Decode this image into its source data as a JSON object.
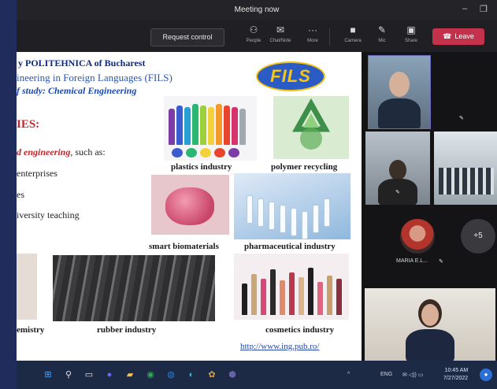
{
  "window": {
    "title": "Meeting now",
    "minimize": "–",
    "restore": "❐"
  },
  "toolbar": {
    "request_control": "Request control",
    "buttons": [
      {
        "icon": "people-icon",
        "glyph": "⚇",
        "label": "People"
      },
      {
        "icon": "chat-icon",
        "glyph": "✉",
        "label": "Chat/Note"
      },
      {
        "icon": "more-icon",
        "glyph": "···",
        "label": "More"
      },
      {
        "icon": "camera-icon",
        "glyph": "■",
        "label": "Camera"
      },
      {
        "icon": "mic-icon",
        "glyph": "✎",
        "label": "Mic"
      },
      {
        "icon": "share-icon",
        "glyph": "▣",
        "label": "Share"
      }
    ],
    "leave_label": "Leave",
    "leave_glyph": "☎",
    "leave_color": "#c4314b"
  },
  "slide": {
    "line1": "y POLITEHNICA of Bucharest",
    "line2": "ineering in Foreign Languages (FILS)",
    "line3": "f study: Chemical Engineering",
    "heading": "IES:",
    "intro_em": "d engineering",
    "intro_rest": ", such as:",
    "item1": "enterprises",
    "item2": "es",
    "item3": "iversity teaching",
    "logo": "FILS",
    "captions": {
      "plastics": "plastics industry",
      "recycling": "polymer recycling",
      "biomaterials": "smart biomaterials",
      "pharma": "pharmaceutical industry",
      "chemistry": "emistry",
      "rubber": "rubber industry",
      "cosmetics": "cosmetics industry"
    },
    "url": "http://www.ing.pub.ro/"
  },
  "panel": {
    "participant_name": "MARIA E.L...",
    "overflow_count": "+5",
    "mic_glyph": "✎"
  },
  "taskbar": {
    "icons": [
      {
        "name": "start-icon",
        "glyph": "⊞",
        "color": "#4aa3ff"
      },
      {
        "name": "search-icon",
        "glyph": "⚲",
        "color": "#e6e6e6"
      },
      {
        "name": "task-view-icon",
        "glyph": "▭",
        "color": "#e6e6e6"
      },
      {
        "name": "chat-app-icon",
        "glyph": "●",
        "color": "#6a6ae8"
      },
      {
        "name": "file-explorer-icon",
        "glyph": "▰",
        "color": "#f2c14e"
      },
      {
        "name": "browser-icon",
        "glyph": "◉",
        "color": "#34a853"
      },
      {
        "name": "store-icon",
        "glyph": "◍",
        "color": "#2b7cd3"
      },
      {
        "name": "edge-icon",
        "glyph": "◐",
        "color": "#37b6d6"
      },
      {
        "name": "paint-icon",
        "glyph": "✿",
        "color": "#e5a23c"
      },
      {
        "name": "teams-icon",
        "glyph": "⬢",
        "color": "#6264a7"
      }
    ],
    "tray_chevron": "^",
    "tray_lang": "ENG",
    "tray_icons": "✉ ◁)) ▭",
    "time": "10:45 AM",
    "date": "7/27/2022"
  }
}
